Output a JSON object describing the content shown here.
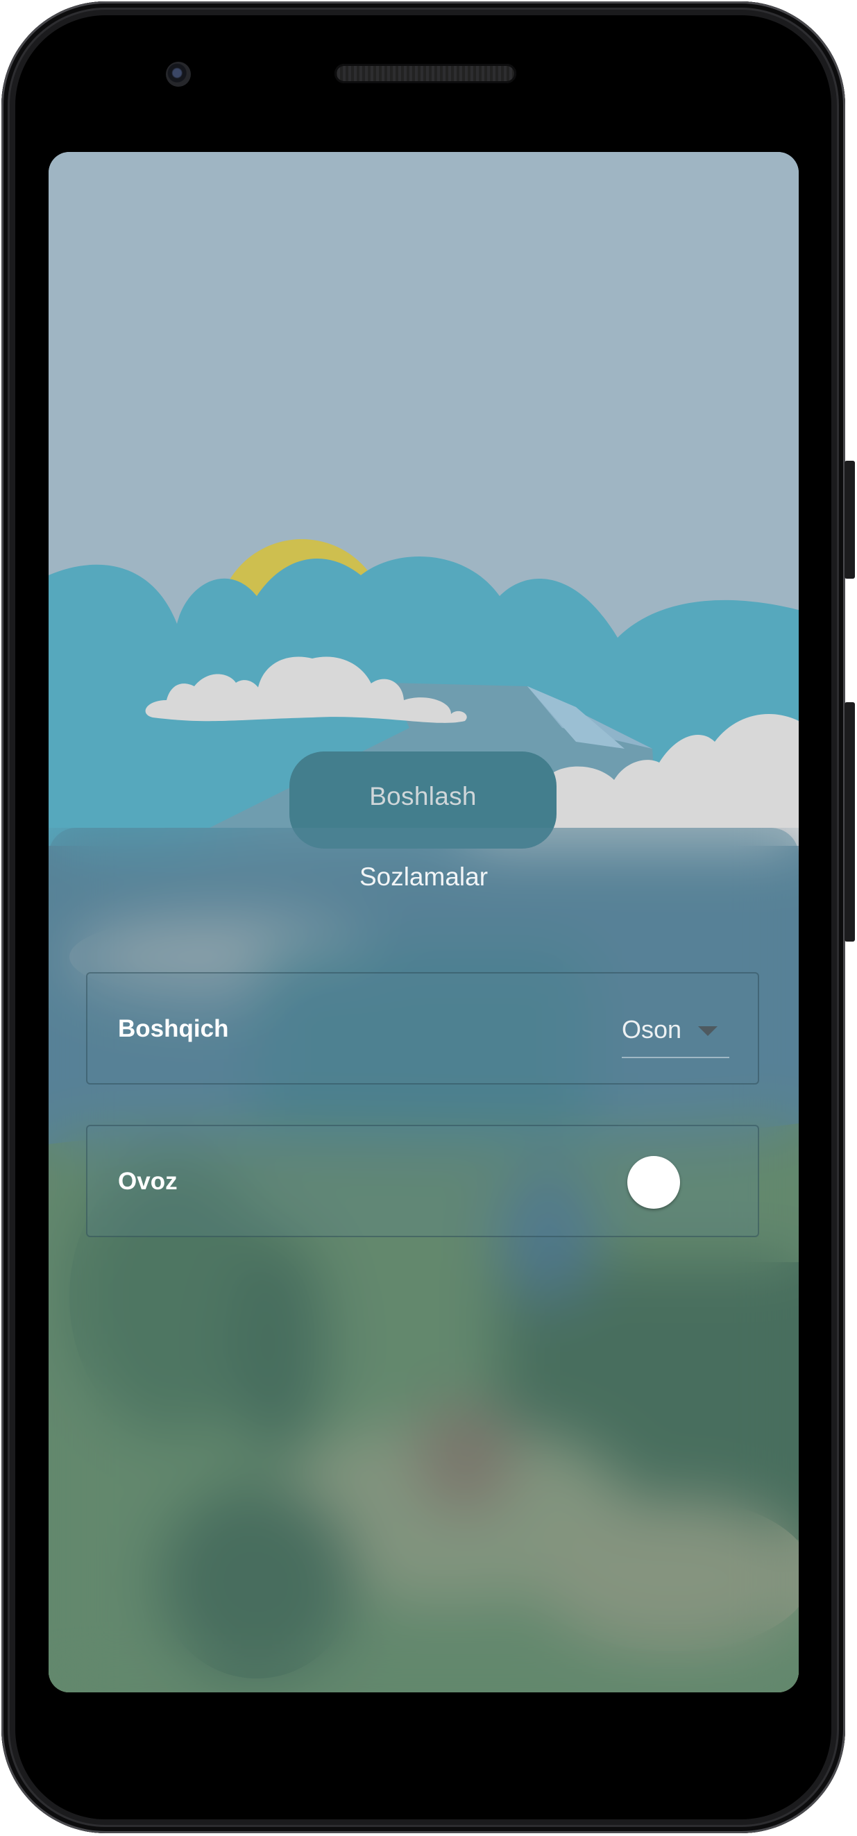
{
  "app": {
    "start_button": "Boshlash",
    "settings": {
      "title": "Sozlamalar",
      "difficulty": {
        "label": "Boshqich",
        "value": "Oson"
      },
      "sound": {
        "label": "Ovoz",
        "enabled": false
      }
    }
  },
  "colors": {
    "sky": "#9fb5c3",
    "clouds_back": "#56a8bd",
    "sun": "#cebf4f",
    "cloud_front": "#d8d8d8",
    "button": "#437e8d"
  },
  "icons": {
    "dropdown": "triangle-down",
    "toggle": "switch-thumb"
  }
}
